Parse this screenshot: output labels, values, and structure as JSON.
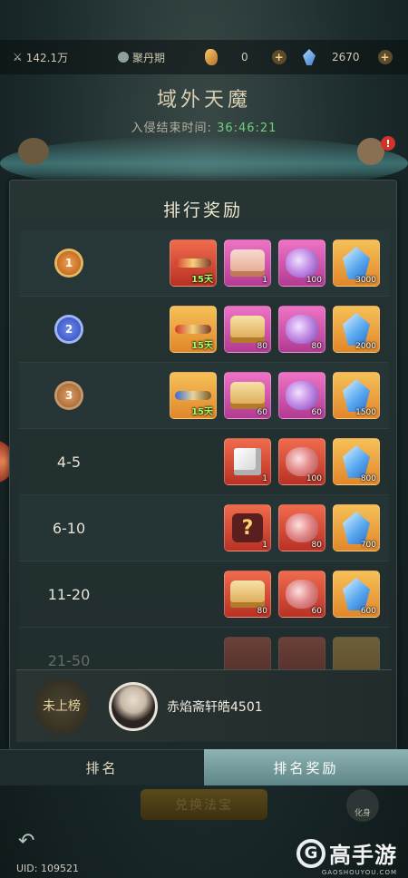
{
  "topbar": {
    "power": "142.1万",
    "realm": "聚丹期",
    "currency_a": "0",
    "currency_b": "2670"
  },
  "event": {
    "title": "域外天魔",
    "timer_label": "入侵结束时间:",
    "timer_value": "36:46:21",
    "badge": "!"
  },
  "panel": {
    "title": "排行奖励",
    "rows": [
      {
        "rank": "1",
        "items": [
          {
            "icon": "sword-icon",
            "days": "15天"
          },
          {
            "icon": "pink-chest-icon",
            "qty": "1"
          },
          {
            "icon": "purple-orb-icon",
            "qty": "100"
          },
          {
            "icon": "blue-crystal-icon",
            "qty": "3000"
          }
        ]
      },
      {
        "rank": "2",
        "items": [
          {
            "icon": "sword-icon",
            "days": "15天"
          },
          {
            "icon": "gold-chest-icon",
            "qty": "80"
          },
          {
            "icon": "purple-orb-icon",
            "qty": "80"
          },
          {
            "icon": "blue-crystal-icon",
            "qty": "2000"
          }
        ]
      },
      {
        "rank": "3",
        "items": [
          {
            "icon": "blue-sword-icon",
            "days": "15天"
          },
          {
            "icon": "gold-chest-icon",
            "qty": "60"
          },
          {
            "icon": "purple-orb-icon",
            "qty": "60"
          },
          {
            "icon": "blue-crystal-icon",
            "qty": "1500"
          }
        ]
      },
      {
        "rank": "4-5",
        "items": [
          {
            "icon": "white-box-icon",
            "qty": "1"
          },
          {
            "icon": "red-orb-icon",
            "qty": "100"
          },
          {
            "icon": "blue-crystal-icon",
            "qty": "800"
          }
        ]
      },
      {
        "rank": "6-10",
        "items": [
          {
            "icon": "mystery-box-icon",
            "qty": "1"
          },
          {
            "icon": "red-orb-icon",
            "qty": "80"
          },
          {
            "icon": "blue-crystal-icon",
            "qty": "700"
          }
        ]
      },
      {
        "rank": "11-20",
        "items": [
          {
            "icon": "gold-chest-icon",
            "qty": "80"
          },
          {
            "icon": "red-orb-icon",
            "qty": "60"
          },
          {
            "icon": "blue-crystal-icon",
            "qty": "600"
          }
        ]
      },
      {
        "rank": "21-50",
        "items": []
      }
    ]
  },
  "me": {
    "rank_label": "未上榜",
    "name": "赤焰斋轩皓4501"
  },
  "tabs": {
    "rank": "排名",
    "reward": "排名奖励"
  },
  "bottom": {
    "exchange": "兑换法宝",
    "side_btn": "化身",
    "uid": "UID: 109521"
  },
  "watermark": {
    "brand": "高手游",
    "site": "GAOSHOUYOU.COM"
  }
}
